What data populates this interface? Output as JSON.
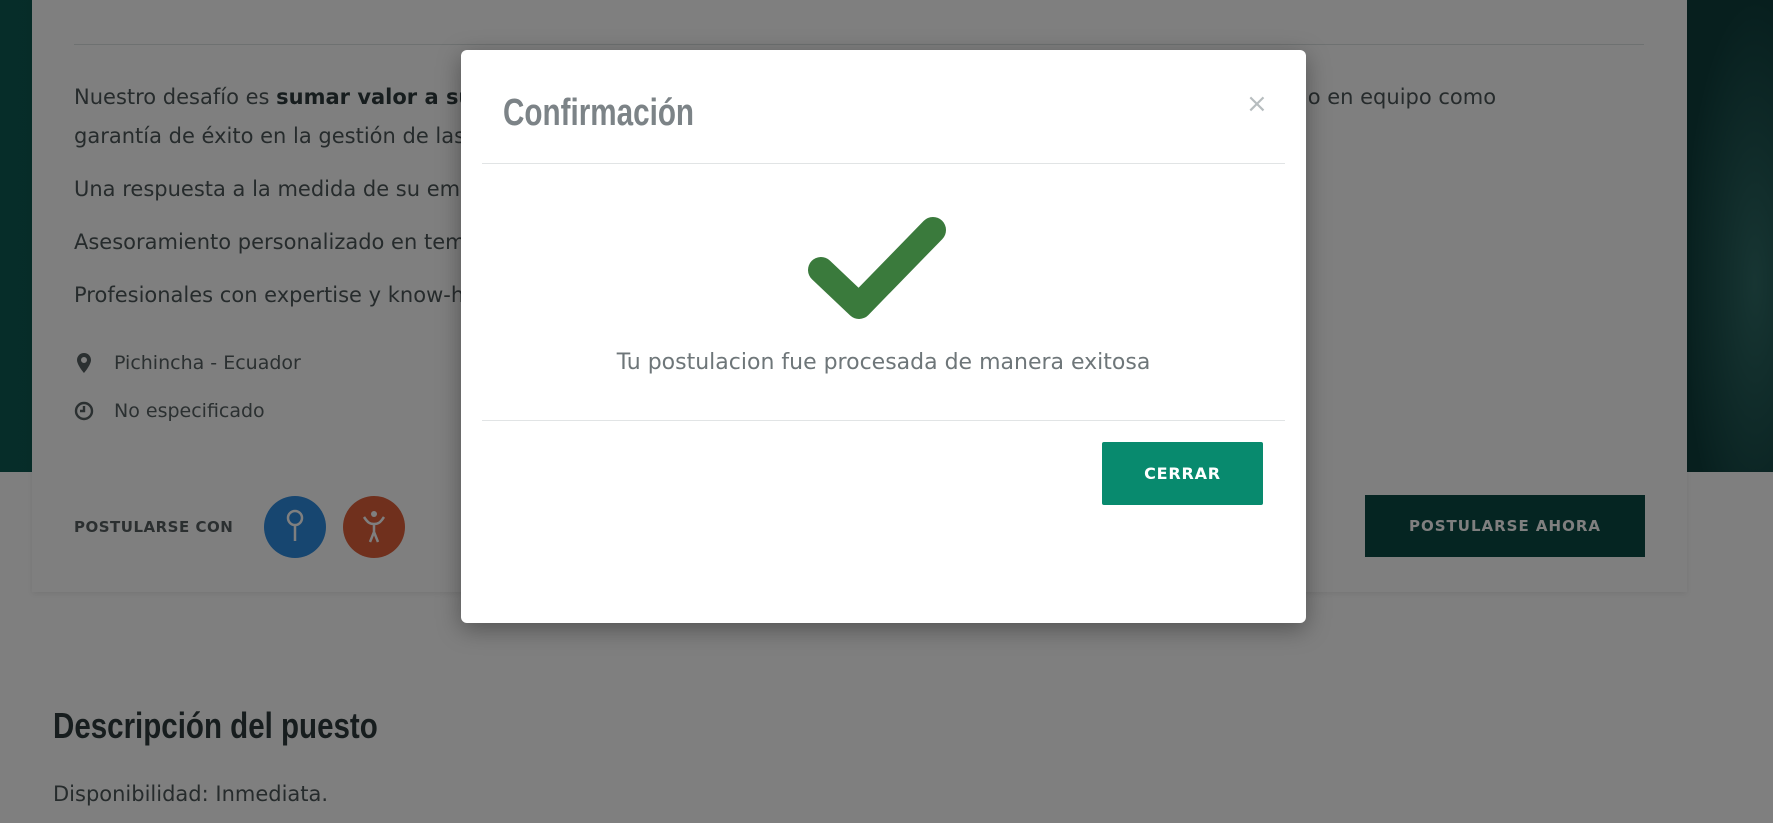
{
  "page": {
    "intro_paragraph_prefix": "Nuestro desafío es ",
    "intro_paragraph_bold": "sumar valor a su",
    "intro_paragraph_tail": "l trabajo en equipo como",
    "intro_paragraph_line2": "garantía de éxito en la gestión de las",
    "bullet_1": "Una respuesta a la medida de su em",
    "bullet_2": "Asesoramiento personalizado en tem",
    "bullet_3": "Profesionales con expertise y know-h",
    "location": "Pichincha - Ecuador",
    "schedule": "No especificado",
    "apply_with_label": "POSTULARSE CON",
    "apply_now_label": "POSTULARSE AHORA",
    "description_title": "Descripción del puesto",
    "description_text": "Disponibilidad: Inmediata."
  },
  "modal": {
    "title": "Confirmación",
    "close_symbol": "×",
    "message": "Tu postulacion fue procesada de manera exitosa",
    "close_button_label": "CERRAR",
    "success_color": "#3a7a3c",
    "button_color": "#088a6e"
  },
  "icons": {
    "location": "map-marker-icon",
    "schedule": "clock-icon",
    "social_1": "key-person-icon",
    "social_2": "figure-icon"
  }
}
